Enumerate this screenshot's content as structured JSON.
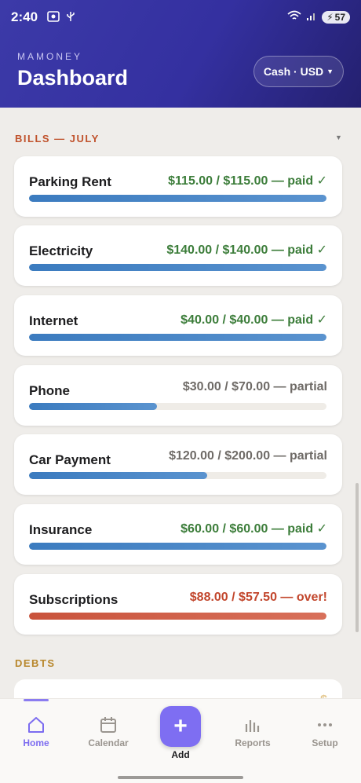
{
  "status": {
    "time": "2:40",
    "battery": "57"
  },
  "header": {
    "app_name": "MAMONEY",
    "title": "Dashboard",
    "account": "Cash · USD"
  },
  "bills": {
    "label": "BILLS — JULY",
    "items": [
      {
        "name": "Parking Rent",
        "amount": "$115.00 / $115.00 — paid ✓",
        "progress": 1.0,
        "status": "paid"
      },
      {
        "name": "Electricity",
        "amount": "$140.00 / $140.00 — paid ✓",
        "progress": 1.0,
        "status": "paid"
      },
      {
        "name": "Internet",
        "amount": "$40.00 / $40.00 — paid ✓",
        "progress": 1.0,
        "status": "paid"
      },
      {
        "name": "Phone",
        "amount": "$30.00 / $70.00 — partial",
        "progress": 0.43,
        "status": "partial"
      },
      {
        "name": "Car Payment",
        "amount": "$120.00 / $200.00 — partial",
        "progress": 0.6,
        "status": "partial"
      },
      {
        "name": "Insurance",
        "amount": "$60.00 / $60.00 — paid ✓",
        "progress": 1.0,
        "status": "paid"
      },
      {
        "name": "Subscriptions",
        "amount": "$88.00 / $57.50 — over!",
        "progress": 1.0,
        "status": "over"
      }
    ]
  },
  "debts": {
    "label": "DEBTS"
  },
  "colors": {
    "header": "#3430a0",
    "bills_label": "#c0522c",
    "debts_label": "#b8872c",
    "paid": "#3c7d3a",
    "partial": "#6e6a66",
    "over": "#c2462c",
    "bar_blue": "#3b7bbf",
    "bar_over": "#c9533c",
    "accent": "#7c6cf0"
  },
  "nav": {
    "home": "Home",
    "calendar": "Calendar",
    "add": "Add",
    "reports": "Reports",
    "setup": "Setup",
    "add_symbol": "+"
  }
}
